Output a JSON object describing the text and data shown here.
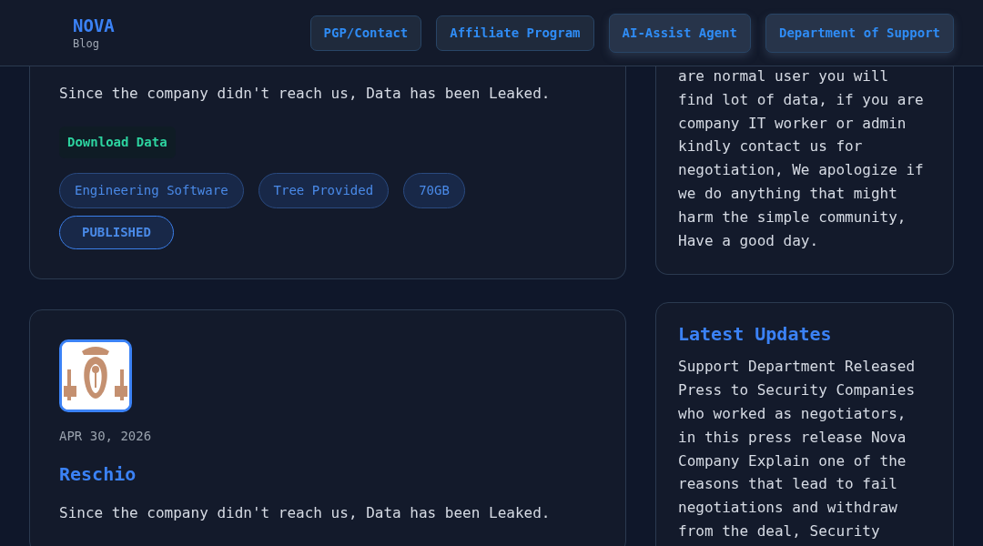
{
  "header": {
    "logo": {
      "title": "NOVA",
      "subtitle": "Blog"
    },
    "nav": [
      {
        "label": "PGP/Contact"
      },
      {
        "label": "Affiliate Program"
      },
      {
        "label": "AI-Assist Agent"
      },
      {
        "label": "Department of Support"
      }
    ]
  },
  "posts": [
    {
      "description": "Since the company didn't reach us, Data has been Leaked.",
      "download_label": "Download Data",
      "tags": [
        "Engineering Software",
        "Tree Provided",
        "70GB"
      ],
      "status": "PUBLISHED"
    },
    {
      "date": "APR 30, 2026",
      "title": "Reschio",
      "description": "Since the company didn't reach us, Data has been Leaked."
    }
  ],
  "sidebar": [
    {
      "text": "are normal user you will find lot of data, if you are company IT worker or admin kindly contact us for negotiation, We apologize if we do anything that might harm the simple community, Have a good day."
    },
    {
      "title": "Latest Updates",
      "text": "Support Department Released Press to Security Companies who worked as negotiators, in this press release Nova Company Explain one of the reasons that lead to fail negotiations and withdraw from the deal, Security"
    }
  ]
}
